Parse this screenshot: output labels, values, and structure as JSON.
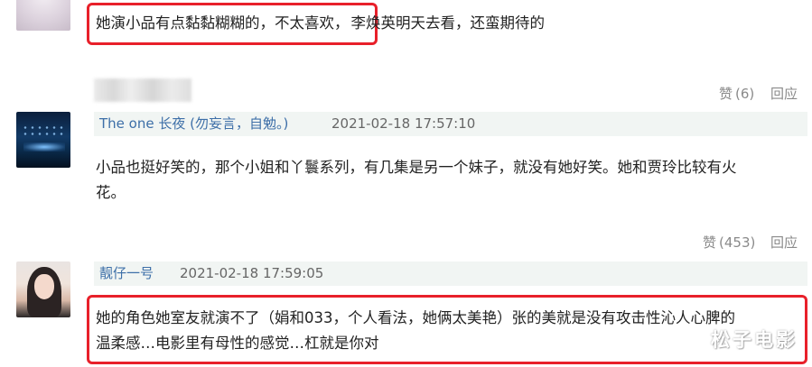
{
  "comments": [
    {
      "text_a": "她演小品有点黏黏糊糊的，不太喜欢，",
      "text_b": "李焕英明天去看，还蛮期待的",
      "actions": {
        "like_label": "赞",
        "like_count": "(6)",
        "reply_label": "回应"
      }
    },
    {
      "user": "The one 长夜 (勿妄言，自勉。)",
      "time": "2021-02-18 17:57:10",
      "line1": "小品也挺好笑的，那个小姐和丫鬟系列，有几集是另一个妹子，就没有她好笑。她和贾玲比较有火",
      "line2": "花。",
      "actions": {
        "like_label": "赞",
        "like_count": "(453)",
        "reply_label": "回应"
      }
    },
    {
      "user": "靓仔一号",
      "time": "2021-02-18 17:59:05",
      "line1": "她的角色她室友就演不了（娟和033，个人看法，她俩太美艳）张的美就是没有攻击性沁人心脾的",
      "line2": "温柔感…电影里有母性的感觉…杠就是你对"
    }
  ],
  "watermark": "松子电影",
  "colors": {
    "highlight": "#e8202a",
    "username": "#3d6fa8",
    "meta_bg": "#f1f5f3"
  }
}
